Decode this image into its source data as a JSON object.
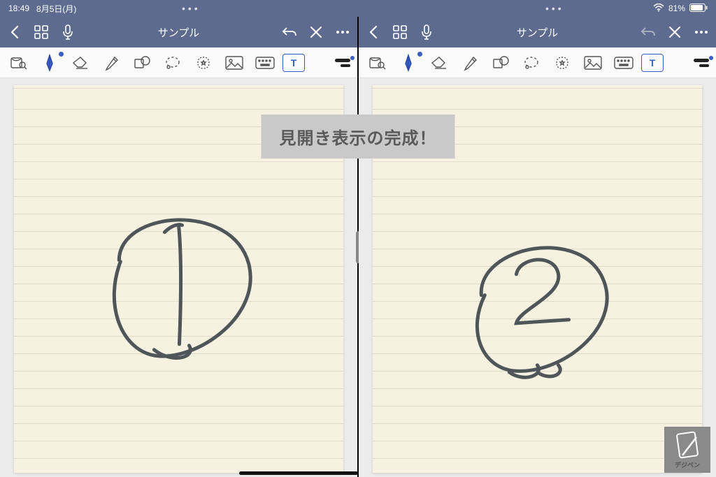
{
  "status": {
    "time": "18:49",
    "date": "8月5日(月)",
    "battery": "81%",
    "ellipsis": "•••"
  },
  "nav": {
    "title": "サンプル"
  },
  "overlay": {
    "text": "見開き表示の完成！"
  },
  "watermark": {
    "label": "デジペン"
  },
  "tools": {
    "text_label": "T"
  },
  "pages": {
    "left_glyph": "1",
    "right_glyph": "2"
  }
}
